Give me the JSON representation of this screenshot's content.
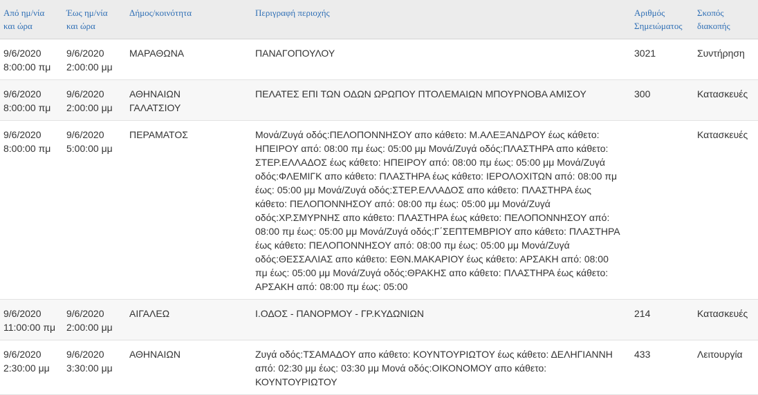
{
  "table": {
    "headers": {
      "from": [
        "Από ημ/νία",
        "και ώρα"
      ],
      "to": [
        "Έως ημ/νία",
        "και ώρα"
      ],
      "municipality": [
        "Δήμος/κοινότητα"
      ],
      "area": [
        "Περιγραφή περιοχής"
      ],
      "notice": [
        "Αριθμός",
        "Σημειώματος"
      ],
      "purpose": [
        "Σκοπός",
        "διακοπής"
      ]
    },
    "rows": [
      {
        "from": [
          "9/6/2020",
          "8:00:00 πμ"
        ],
        "to": [
          "9/6/2020",
          "2:00:00 μμ"
        ],
        "municipality": [
          "ΜΑΡΑΘΩΝΑ"
        ],
        "area": "ΠΑΝΑΓΟΠΟΥΛΟΥ",
        "notice": "3021",
        "purpose": "Συντήρηση"
      },
      {
        "from": [
          "9/6/2020",
          "8:00:00 πμ"
        ],
        "to": [
          "9/6/2020",
          "2:00:00 μμ"
        ],
        "municipality": [
          "ΑΘΗΝΑΙΩΝ",
          "ΓΑΛΑΤΣΙΟΥ"
        ],
        "area": "ΠΕΛΑΤΕΣ ΕΠΙ ΤΩΝ ΟΔΩΝ ΩΡΩΠΟΥ ΠΤΟΛΕΜΑΙΩΝ ΜΠΟΥΡΝΟΒΑ ΑΜΙΣΟΥ",
        "notice": "300",
        "purpose": "Κατασκευές"
      },
      {
        "from": [
          "9/6/2020",
          "8:00:00 πμ"
        ],
        "to": [
          "9/6/2020",
          "5:00:00 μμ"
        ],
        "municipality": [
          "ΠΕΡΑΜΑΤΟΣ"
        ],
        "area": "Μονά/Ζυγά οδός:ΠΕΛΟΠΟΝΝΗΣΟΥ απο κάθετο: Μ.ΑΛΕΞΑΝΔΡΟΥ έως κάθετο: ΗΠΕΙΡΟΥ από: 08:00 πμ έως: 05:00 μμ Μονά/Ζυγά οδός:ΠΛΑΣΤΗΡΑ απο κάθετο: ΣΤΕΡ.ΕΛΛΑΔΟΣ έως κάθετο: ΗΠΕΙΡΟΥ από: 08:00 πμ έως: 05:00 μμ Μονά/Ζυγά οδός:ΦΛΕΜΙΓΚ απο κάθετο: ΠΛΑΣΤΗΡΑ έως κάθετο: ΙΕΡΟΛΟΧΙΤΩΝ από: 08:00 πμ έως: 05:00 μμ Μονά/Ζυγά οδός:ΣΤΕΡ.ΕΛΛΑΔΟΣ απο κάθετο: ΠΛΑΣΤΗΡΑ έως κάθετο: ΠΕΛΟΠΟΝΝΗΣΟΥ από: 08:00 πμ έως: 05:00 μμ Μονά/Ζυγά οδός:ΧΡ.ΣΜΥΡΝΗΣ απο κάθετο: ΠΛΑΣΤΗΡΑ έως κάθετο: ΠΕΛΟΠΟΝΝΗΣΟΥ από: 08:00 πμ έως: 05:00 μμ Μονά/Ζυγά οδός:Γ΄ΣΕΠΤΕΜΒΡΙΟΥ απο κάθετο: ΠΛΑΣΤΗΡΑ έως κάθετο: ΠΕΛΟΠΟΝΝΗΣΟΥ από: 08:00 πμ έως: 05:00 μμ Μονά/Ζυγά οδός:ΘΕΣΣΑΛΙΑΣ απο κάθετο: ΕΘΝ.ΜΑΚΑΡΙΟΥ έως κάθετο: ΑΡΣΑΚΗ από: 08:00 πμ έως: 05:00 μμ Μονά/Ζυγά οδός:ΘΡΑΚΗΣ απο κάθετο: ΠΛΑΣΤΗΡΑ έως κάθετο: ΑΡΣΑΚΗ από: 08:00 πμ έως: 05:00",
        "notice": "",
        "purpose": "Κατασκευές"
      },
      {
        "from": [
          "9/6/2020",
          "11:00:00 πμ"
        ],
        "to": [
          "9/6/2020",
          "2:00:00 μμ"
        ],
        "municipality": [
          "ΑΙΓΑΛΕΩ"
        ],
        "area": "Ι.ΟΔΟΣ - ΠΑΝΟΡΜΟΥ - ΓΡ.ΚΥΔΩΝΙΩΝ",
        "notice": "214",
        "purpose": "Κατασκευές"
      },
      {
        "from": [
          "9/6/2020",
          "2:30:00 μμ"
        ],
        "to": [
          "9/6/2020",
          "3:30:00 μμ"
        ],
        "municipality": [
          "ΑΘΗΝΑΙΩΝ"
        ],
        "area": "Ζυγά οδός:ΤΣΑΜΑΔΟΥ απο κάθετο: ΚΟΥΝΤΟΥΡΙΩΤΟΥ έως κάθετο: ΔΕΛΗΓΙΑΝΝΗ από: 02:30 μμ έως: 03:30 μμ Μονά οδός:ΟΙΚΟΝΟΜΟΥ απο κάθετο: ΚΟΥΝΤΟΥΡΙΩΤΟΥ",
        "notice": "433",
        "purpose": "Λειτουργία"
      }
    ]
  }
}
